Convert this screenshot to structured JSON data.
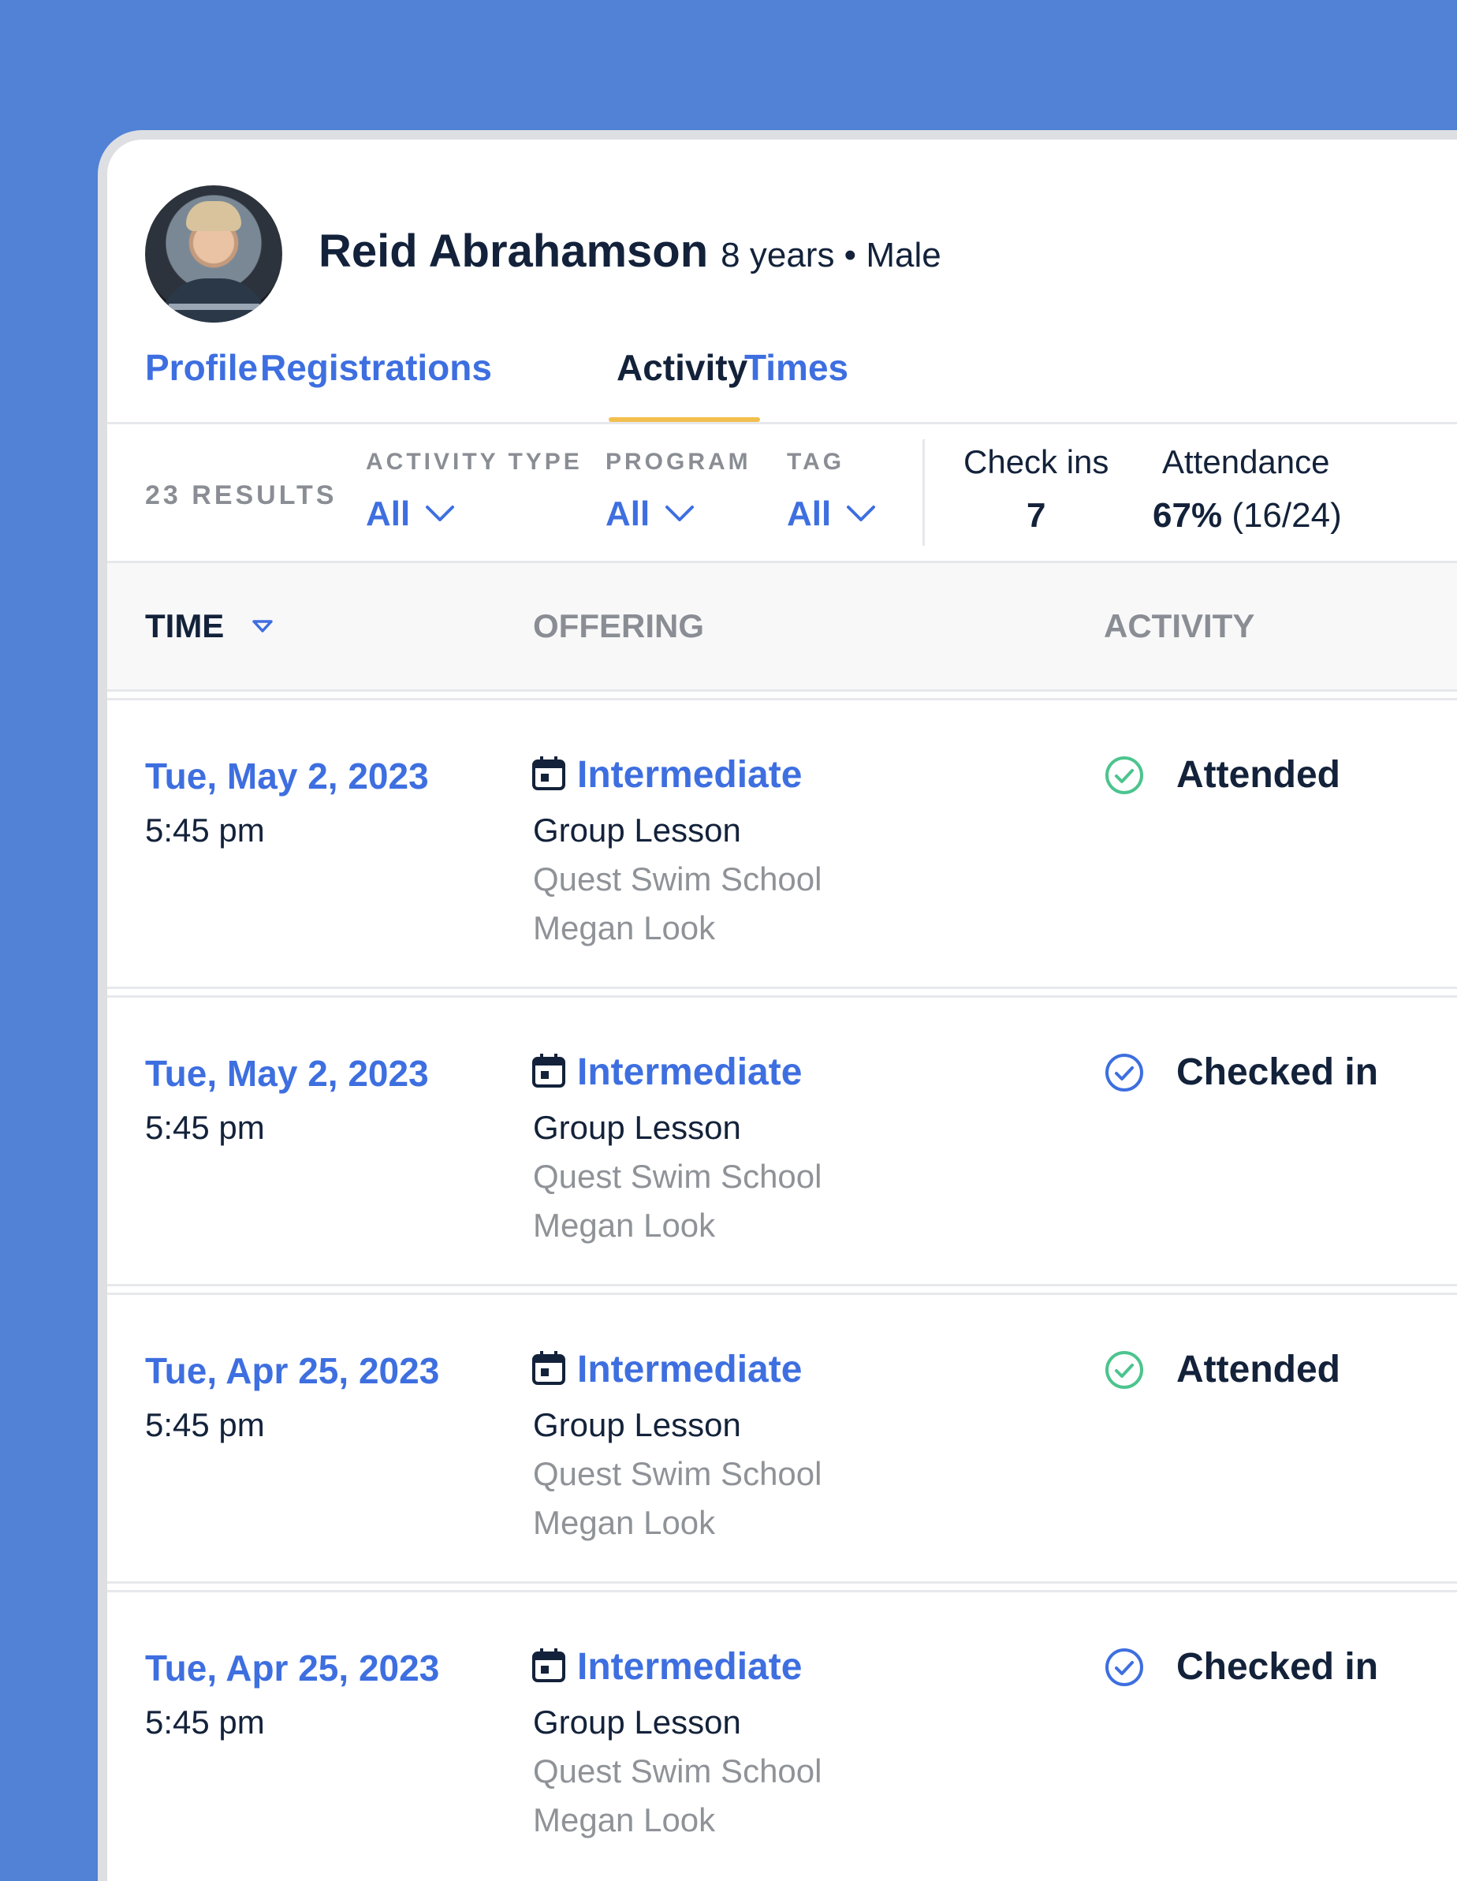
{
  "person": {
    "name": "Reid Abrahamson",
    "meta": "8 years • Male"
  },
  "tabs": [
    "Profile",
    "Registrations",
    "Activity",
    "Times"
  ],
  "filters": {
    "results": "23 RESULTS",
    "activity_type": {
      "label": "ACTIVITY TYPE",
      "value": "All"
    },
    "program": {
      "label": "PROGRAM",
      "value": "All"
    },
    "tag": {
      "label": "TAG",
      "value": "All"
    }
  },
  "stats": {
    "checkins": {
      "label": "Check ins",
      "value": "7"
    },
    "attendance": {
      "label": "Attendance",
      "percent": "67%",
      "fraction": "(16/24)"
    }
  },
  "table": {
    "col_time": "TIME",
    "col_offering": "OFFERING",
    "col_activity": "ACTIVITY"
  },
  "rows": [
    {
      "date": "Tue, May 2, 2023",
      "time": "5:45 pm",
      "offering": "Intermediate",
      "type": "Group Lesson",
      "school": "Quest Swim School",
      "instructor": "Megan Look",
      "status": "Attended",
      "status_icon": "check-circle-green-icon"
    },
    {
      "date": "Tue, May 2, 2023",
      "time": "5:45 pm",
      "offering": "Intermediate",
      "type": "Group Lesson",
      "school": "Quest Swim School",
      "instructor": "Megan Look",
      "status": "Checked in",
      "status_icon": "check-circle-blue-icon"
    },
    {
      "date": "Tue, Apr 25, 2023",
      "time": "5:45 pm",
      "offering": "Intermediate",
      "type": "Group Lesson",
      "school": "Quest Swim School",
      "instructor": "Megan Look",
      "status": "Attended",
      "status_icon": "check-circle-green-icon"
    },
    {
      "date": "Tue, Apr 25, 2023",
      "time": "5:45 pm",
      "offering": "Intermediate",
      "type": "Group Lesson",
      "school": "Quest Swim School",
      "instructor": "Megan Look",
      "status": "Checked in",
      "status_icon": "check-circle-blue-icon"
    }
  ],
  "colors": {
    "background": "#5182D6",
    "link": "#3E6FE0",
    "attended": "#4CC48E",
    "checked_in": "#3E6FE0",
    "tab_underline": "#F2BF4E"
  }
}
